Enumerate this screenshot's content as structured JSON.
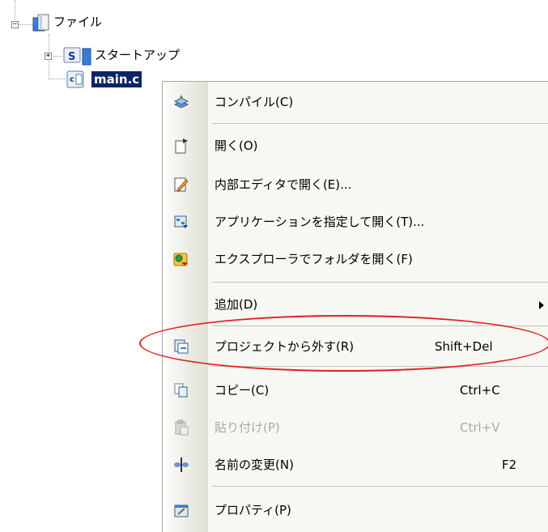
{
  "tree": {
    "root": {
      "label": "ファイル",
      "expander": "−"
    },
    "children": [
      {
        "label": "スタートアップ",
        "expander": "+",
        "icon": "s-folder-icon"
      },
      {
        "label": "main.c",
        "icon": "c-file-icon",
        "selected": true
      }
    ]
  },
  "menu": {
    "items": [
      {
        "label": "コンパイル(C)",
        "icon": "compile-icon"
      },
      {
        "label": "開く(O)",
        "icon": "open-icon"
      },
      {
        "label": "内部エディタで開く(E)...",
        "icon": "internal-editor-icon"
      },
      {
        "label": "アプリケーションを指定して開く(T)...",
        "icon": "open-with-app-icon"
      },
      {
        "label": "エクスプローラでフォルダを開く(F)",
        "icon": "explorer-folder-icon"
      },
      {
        "label": "追加(D)",
        "submenu": true
      },
      {
        "label": "プロジェクトから外す(R)",
        "shortcut": "Shift+Del",
        "icon": "remove-from-project-icon"
      },
      {
        "label": "コピー(C)",
        "shortcut": "Ctrl+C",
        "icon": "copy-icon"
      },
      {
        "label": "貼り付け(P)",
        "shortcut": "Ctrl+V",
        "icon": "paste-icon",
        "disabled": true
      },
      {
        "label": "名前の変更(N)",
        "shortcut": "F2",
        "icon": "rename-icon"
      },
      {
        "label": "プロパティ(P)",
        "icon": "properties-icon"
      }
    ],
    "submenu_arrow": "▶"
  },
  "colors": {
    "selection": "#0a246a",
    "highlight_ellipse": "#e02020",
    "disabled_text": "#a8a8a8"
  }
}
